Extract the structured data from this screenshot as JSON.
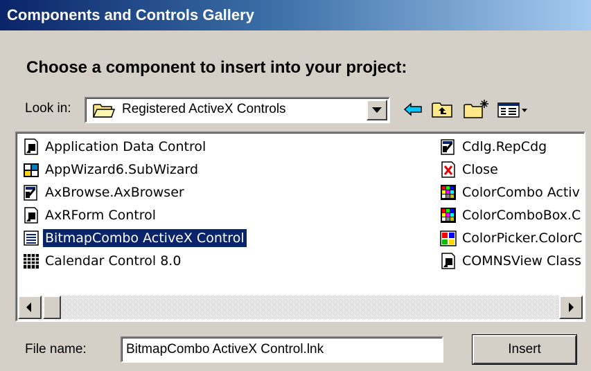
{
  "window": {
    "title": "Components and Controls Gallery"
  },
  "heading": "Choose a component to insert into your project:",
  "lookin": {
    "label": "Look in:",
    "value": "Registered ActiveX Controls",
    "icon": "folder-icon"
  },
  "toolbar": {
    "back_icon": "back-arrow-icon",
    "up_icon": "up-one-level-icon",
    "newfolder_icon": "new-folder-icon",
    "views_icon": "view-menu-icon"
  },
  "items_left": [
    {
      "label": "Application Data Control",
      "icon": "control-document-icon",
      "selected": false
    },
    {
      "label": "AppWizard6.SubWizard",
      "icon": "wizard-icon",
      "selected": false
    },
    {
      "label": "AxBrowse.AxBrowser",
      "icon": "browser-control-icon",
      "selected": false
    },
    {
      "label": "AxRForm Control",
      "icon": "control-document-icon",
      "selected": false
    },
    {
      "label": "BitmapCombo ActiveX Control",
      "icon": "combo-control-icon",
      "selected": true
    },
    {
      "label": "Calendar Control 8.0",
      "icon": "calendar-icon",
      "selected": false
    }
  ],
  "items_right": [
    {
      "label": "Cdlg.RepCdg",
      "icon": "browser-control-icon"
    },
    {
      "label": "Close",
      "icon": "close-document-icon"
    },
    {
      "label": "ColorCombo Activ",
      "icon": "color-grid-icon"
    },
    {
      "label": "ColorComboBox.C",
      "icon": "color-grid-icon"
    },
    {
      "label": "ColorPicker.ColorC",
      "icon": "color-picker-icon"
    },
    {
      "label": "COMNSView Class",
      "icon": "control-document-icon"
    }
  ],
  "file_name": {
    "label": "File name:",
    "value": "BitmapCombo ActiveX Control.lnk"
  },
  "buttons": {
    "insert": "Insert"
  },
  "colors": {
    "selection": "#0a246a",
    "dialog_face": "#d4d0c8",
    "title_gradient_start": "#0a246a",
    "title_gradient_end": "#a6caf0"
  }
}
